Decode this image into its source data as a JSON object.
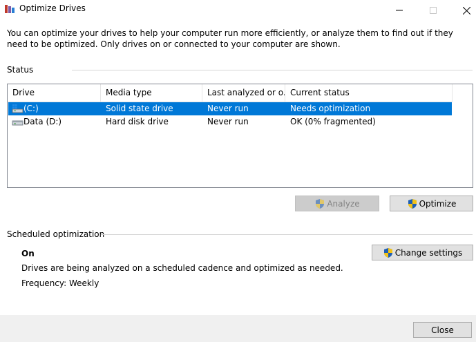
{
  "window": {
    "title": "Optimize Drives"
  },
  "description": "You can optimize your drives to help your computer run more efficiently, or analyze them to find out if they need to be optimized. Only drives on or connected to your computer are shown.",
  "status_section": {
    "label": "Status",
    "columns": [
      "Drive",
      "Media type",
      "Last analyzed or o...",
      "Current status"
    ],
    "drives": [
      {
        "drive": "(C:)",
        "media_type": "Solid state drive",
        "last_analyzed": "Never run",
        "current_status": "Needs optimization",
        "selected": true,
        "icon": "windows-drive-icon"
      },
      {
        "drive": "Data (D:)",
        "media_type": "Hard disk drive",
        "last_analyzed": "Never run",
        "current_status": "OK (0% fragmented)",
        "selected": false,
        "icon": "hard-disk-icon"
      }
    ],
    "analyze_label": "Analyze",
    "optimize_label": "Optimize"
  },
  "scheduled": {
    "label": "Scheduled optimization",
    "status": "On",
    "description": "Drives are being analyzed on a scheduled cadence and optimized as needed.",
    "frequency": "Frequency: Weekly",
    "change_settings_label": "Change settings"
  },
  "footer": {
    "close_label": "Close"
  },
  "colors": {
    "selection": "#0078d7",
    "shield_blue": "#1f5fb4",
    "shield_yellow": "#f3c318"
  }
}
